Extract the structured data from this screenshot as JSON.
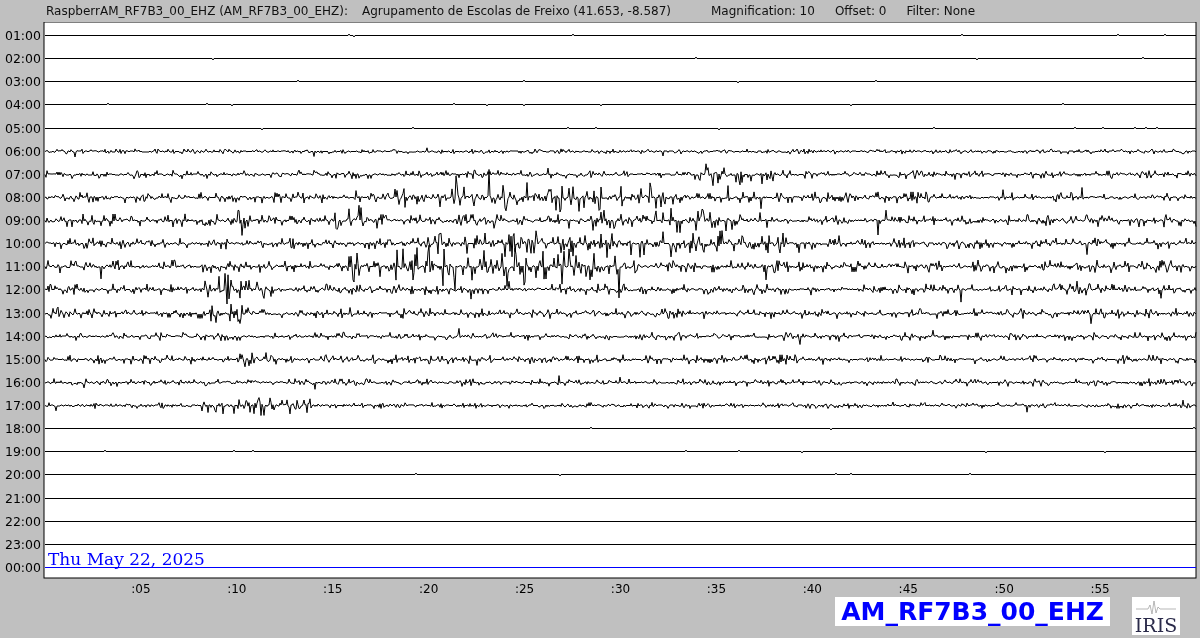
{
  "header": {
    "station": "RaspberrAM_RF7B3_00_EHZ (AM_RF7B3_00_EHZ):",
    "location": "Agrupamento de Escolas de Freixo (41.653, -8.587)",
    "magnification": "Magnification: 10",
    "offset": "Offset: 0",
    "filter": "Filter: None"
  },
  "rows": [
    {
      "label": "01:00",
      "color": "#000000"
    },
    {
      "label": "02:00",
      "color": "#000000"
    },
    {
      "label": "03:00",
      "color": "#000000"
    },
    {
      "label": "04:00",
      "color": "#000000"
    },
    {
      "label": "05:00",
      "color": "#000000"
    },
    {
      "label": "06:00",
      "color": "#000000"
    },
    {
      "label": "07:00",
      "color": "#000000"
    },
    {
      "label": "08:00",
      "color": "#000000"
    },
    {
      "label": "09:00",
      "color": "#000000"
    },
    {
      "label": "10:00",
      "color": "#000000"
    },
    {
      "label": "11:00",
      "color": "#000000"
    },
    {
      "label": "12:00",
      "color": "#000000"
    },
    {
      "label": "13:00",
      "color": "#000000"
    },
    {
      "label": "14:00",
      "color": "#000000"
    },
    {
      "label": "15:00",
      "color": "#000000"
    },
    {
      "label": "16:00",
      "color": "#000000"
    },
    {
      "label": "17:00",
      "color": "#000000"
    },
    {
      "label": "18:00",
      "color": "#000000"
    },
    {
      "label": "19:00",
      "color": "#000000"
    },
    {
      "label": "20:00",
      "color": "#000000"
    },
    {
      "label": "21:00",
      "color": "#000000"
    },
    {
      "label": "22:00",
      "color": "#000000"
    },
    {
      "label": "23:00",
      "color": "#000000"
    },
    {
      "label": "00:00",
      "color": "#0000ff"
    }
  ],
  "x_ticks": [
    ":05",
    ":10",
    ":15",
    ":20",
    ":25",
    ":30",
    ":35",
    ":40",
    ":45",
    ":50",
    ":55"
  ],
  "date": "Thu May 22, 2025",
  "station_label": "AM_RF7B3_00_EHZ",
  "logo_text": "IRIS"
}
